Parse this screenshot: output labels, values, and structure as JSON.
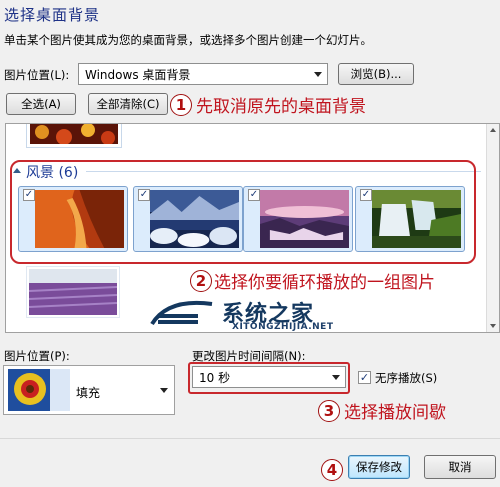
{
  "header": {
    "title": "选择桌面背景",
    "subtitle": "单击某个图片使其成为您的桌面背景，或选择多个图片创建一个幻灯片。"
  },
  "location": {
    "label": "图片位置(L):",
    "value": "Windows 桌面背景",
    "browse_label": "浏览(B)..."
  },
  "selection": {
    "select_all": "全选(A)",
    "clear_all": "全部清除(C)"
  },
  "gallery": {
    "group_title": "风景 (6)",
    "thumbnails": [
      {
        "name": "canyon",
        "checked": true
      },
      {
        "name": "snowy-lake",
        "checked": true
      },
      {
        "name": "coast-sunset",
        "checked": true
      },
      {
        "name": "waterfall",
        "checked": true
      }
    ]
  },
  "position": {
    "label": "图片位置(P):",
    "value": "填充"
  },
  "interval": {
    "label": "更改图片时间间隔(N):",
    "value": "10 秒"
  },
  "shuffle": {
    "label": "无序播放(S)",
    "checked": true
  },
  "footer": {
    "save_label": "保存修改",
    "cancel_label": "取消"
  },
  "annotations": [
    {
      "number": "1",
      "text": "先取消原先的桌面背景"
    },
    {
      "number": "2",
      "text": "选择你要循环播放的一组图片"
    },
    {
      "number": "3",
      "text": "选择播放间歇"
    },
    {
      "number": "4",
      "text": ""
    }
  ],
  "watermark": {
    "name": "系统之家",
    "url": "XITONGZHIJIA.NET"
  },
  "colors": {
    "annotation_red": "#c0141e",
    "title_blue": "#1e3287",
    "highlight_red": "#c8282d"
  }
}
